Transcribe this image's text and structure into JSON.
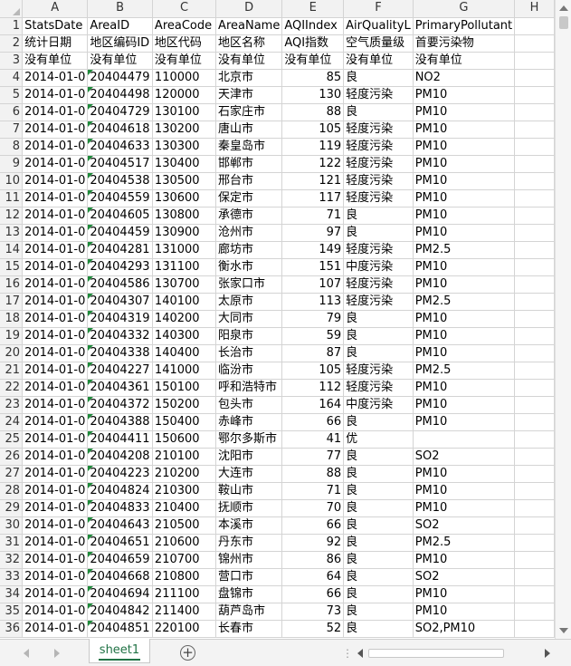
{
  "columns": [
    "A",
    "B",
    "C",
    "D",
    "E",
    "F",
    "G",
    "H"
  ],
  "rows": [
    {
      "n": "1",
      "c": [
        "StatsDate",
        "AreaID",
        "AreaCode",
        "AreaName",
        "AQIIndex",
        "AirQualityL",
        "PrimaryPollutant",
        ""
      ]
    },
    {
      "n": "2",
      "c": [
        "统计日期",
        "地区编码ID",
        "地区代码",
        "地区名称",
        "AQI指数",
        "空气质量级",
        "首要污染物",
        ""
      ]
    },
    {
      "n": "3",
      "c": [
        "没有单位",
        "没有单位",
        "没有单位",
        "没有单位",
        "没有单位",
        "没有单位",
        "没有单位",
        ""
      ]
    },
    {
      "n": "4",
      "c": [
        "2014-01-0",
        "20404479",
        "110000",
        "北京市",
        "85",
        "良",
        "NO2",
        ""
      ]
    },
    {
      "n": "5",
      "c": [
        "2014-01-0",
        "20404498",
        "120000",
        "天津市",
        "130",
        "轻度污染",
        "PM10",
        ""
      ]
    },
    {
      "n": "6",
      "c": [
        "2014-01-0",
        "20404729",
        "130100",
        "石家庄市",
        "88",
        "良",
        "PM10",
        ""
      ]
    },
    {
      "n": "7",
      "c": [
        "2014-01-0",
        "20404618",
        "130200",
        "唐山市",
        "105",
        "轻度污染",
        "PM10",
        ""
      ]
    },
    {
      "n": "8",
      "c": [
        "2014-01-0",
        "20404633",
        "130300",
        "秦皇岛市",
        "119",
        "轻度污染",
        "PM10",
        ""
      ]
    },
    {
      "n": "9",
      "c": [
        "2014-01-0",
        "20404517",
        "130400",
        "邯郸市",
        "122",
        "轻度污染",
        "PM10",
        ""
      ]
    },
    {
      "n": "10",
      "c": [
        "2014-01-0",
        "20404538",
        "130500",
        "邢台市",
        "121",
        "轻度污染",
        "PM10",
        ""
      ]
    },
    {
      "n": "11",
      "c": [
        "2014-01-0",
        "20404559",
        "130600",
        "保定市",
        "117",
        "轻度污染",
        "PM10",
        ""
      ]
    },
    {
      "n": "12",
      "c": [
        "2014-01-0",
        "20404605",
        "130800",
        "承德市",
        "71",
        "良",
        "PM10",
        ""
      ]
    },
    {
      "n": "13",
      "c": [
        "2014-01-0",
        "20404459",
        "130900",
        "沧州市",
        "97",
        "良",
        "PM10",
        ""
      ]
    },
    {
      "n": "14",
      "c": [
        "2014-01-0",
        "20404281",
        "131000",
        "廊坊市",
        "149",
        "轻度污染",
        "PM2.5",
        ""
      ]
    },
    {
      "n": "15",
      "c": [
        "2014-01-0",
        "20404293",
        "131100",
        "衡水市",
        "151",
        "中度污染",
        "PM10",
        ""
      ]
    },
    {
      "n": "16",
      "c": [
        "2014-01-0",
        "20404586",
        "130700",
        "张家口市",
        "107",
        "轻度污染",
        "PM10",
        ""
      ]
    },
    {
      "n": "17",
      "c": [
        "2014-01-0",
        "20404307",
        "140100",
        "太原市",
        "113",
        "轻度污染",
        "PM2.5",
        ""
      ]
    },
    {
      "n": "18",
      "c": [
        "2014-01-0",
        "20404319",
        "140200",
        "大同市",
        "79",
        "良",
        "PM10",
        ""
      ]
    },
    {
      "n": "19",
      "c": [
        "2014-01-0",
        "20404332",
        "140300",
        "阳泉市",
        "59",
        "良",
        "PM10",
        ""
      ]
    },
    {
      "n": "20",
      "c": [
        "2014-01-0",
        "20404338",
        "140400",
        "长治市",
        "87",
        "良",
        "PM10",
        ""
      ]
    },
    {
      "n": "21",
      "c": [
        "2014-01-0",
        "20404227",
        "141000",
        "临汾市",
        "105",
        "轻度污染",
        "PM2.5",
        ""
      ]
    },
    {
      "n": "22",
      "c": [
        "2014-01-0",
        "20404361",
        "150100",
        "呼和浩特市",
        "112",
        "轻度污染",
        "PM10",
        ""
      ]
    },
    {
      "n": "23",
      "c": [
        "2014-01-0",
        "20404372",
        "150200",
        "包头市",
        "164",
        "中度污染",
        "PM10",
        ""
      ]
    },
    {
      "n": "24",
      "c": [
        "2014-01-0",
        "20404388",
        "150400",
        "赤峰市",
        "66",
        "良",
        "PM10",
        ""
      ]
    },
    {
      "n": "25",
      "c": [
        "2014-01-0",
        "20404411",
        "150600",
        "鄂尔多斯市",
        "41",
        "优",
        "",
        ""
      ]
    },
    {
      "n": "26",
      "c": [
        "2014-01-0",
        "20404208",
        "210100",
        "沈阳市",
        "77",
        "良",
        "SO2",
        ""
      ]
    },
    {
      "n": "27",
      "c": [
        "2014-01-0",
        "20404223",
        "210200",
        "大连市",
        "88",
        "良",
        "PM10",
        ""
      ]
    },
    {
      "n": "28",
      "c": [
        "2014-01-0",
        "20404824",
        "210300",
        "鞍山市",
        "71",
        "良",
        "PM10",
        ""
      ]
    },
    {
      "n": "29",
      "c": [
        "2014-01-0",
        "20404833",
        "210400",
        "抚顺市",
        "70",
        "良",
        "PM10",
        ""
      ]
    },
    {
      "n": "30",
      "c": [
        "2014-01-0",
        "20404643",
        "210500",
        "本溪市",
        "66",
        "良",
        "SO2",
        ""
      ]
    },
    {
      "n": "31",
      "c": [
        "2014-01-0",
        "20404651",
        "210600",
        "丹东市",
        "92",
        "良",
        "PM2.5",
        ""
      ]
    },
    {
      "n": "32",
      "c": [
        "2014-01-0",
        "20404659",
        "210700",
        "锦州市",
        "86",
        "良",
        "PM10",
        ""
      ]
    },
    {
      "n": "33",
      "c": [
        "2014-01-0",
        "20404668",
        "210800",
        "营口市",
        "64",
        "良",
        "SO2",
        ""
      ]
    },
    {
      "n": "34",
      "c": [
        "2014-01-0",
        "20404694",
        "211100",
        "盘锦市",
        "66",
        "良",
        "PM10",
        ""
      ]
    },
    {
      "n": "35",
      "c": [
        "2014-01-0",
        "20404842",
        "211400",
        "葫芦岛市",
        "73",
        "良",
        "PM10",
        ""
      ]
    },
    {
      "n": "36",
      "c": [
        "2014-01-0",
        "20404851",
        "220100",
        "长春市",
        "52",
        "良",
        "SO2,PM10",
        ""
      ]
    }
  ],
  "sheet_tab": "sheet1",
  "add_sheet_symbol": "+",
  "tab_separator": "⋮",
  "colors": {
    "accent": "#217346",
    "text_marker": "#1e8a3a",
    "header_bg": "#f2f2f2"
  }
}
